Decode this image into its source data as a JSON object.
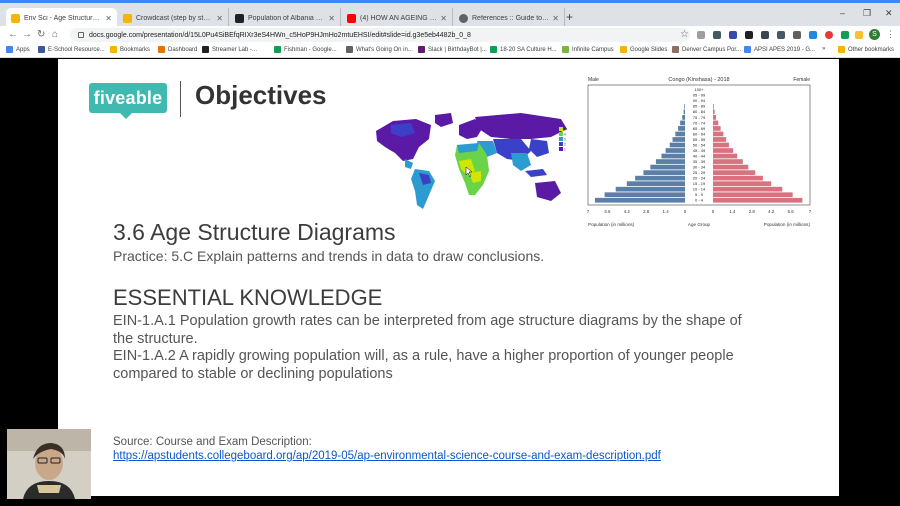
{
  "browser": {
    "tabs": [
      {
        "title": "Env Sci - Age Structure Diagrams",
        "icon": "slides-icon",
        "color": "#f4b400",
        "active": true
      },
      {
        "title": "Crowdcast (step by step) - Google",
        "icon": "slides-icon",
        "color": "#f4b400",
        "active": false
      },
      {
        "title": "Population of Albania 2017 - Pop",
        "icon": "site-icon",
        "color": "#202124",
        "active": false
      },
      {
        "title": "(4) HOW AN AGEING POPULATIO",
        "icon": "youtube-icon",
        "color": "#ff0000",
        "active": false
      },
      {
        "title": "References :: Guide to Country P",
        "icon": "globe-icon",
        "color": "#5f6368",
        "active": false
      }
    ],
    "url": "docs.google.com/presentation/d/15L0Pu4SiBEfqRIXr3eS4HWn_c5HoP9HJmHo2mtuEHSI/edit#slide=id.g3e5eb4482b_0_8",
    "bookmarks": [
      {
        "label": "Apps",
        "color": "#4285f4"
      },
      {
        "label": "E-School Resource...",
        "color": "#3b5998"
      },
      {
        "label": "Bookmarks",
        "color": "#f4b400"
      },
      {
        "label": "Dashboard",
        "color": "#e37400"
      },
      {
        "label": "Streamer Lab -...",
        "color": "#202124"
      },
      {
        "label": "Fishman - Google...",
        "color": "#0f9d58"
      },
      {
        "label": "What's Going On in...",
        "color": "#5f6368"
      },
      {
        "label": "Slack | BirthdayBot |...",
        "color": "#611f69"
      },
      {
        "label": "18-20 SA Culture H...",
        "color": "#0f9d58"
      },
      {
        "label": "Infinite Campus",
        "color": "#7cb342"
      },
      {
        "label": "Google Slides",
        "color": "#f4b400"
      },
      {
        "label": "Denver Campus Por...",
        "color": "#8d6e63"
      },
      {
        "label": "APSI APES 2019 - G...",
        "color": "#4285f4"
      },
      {
        "label": "Other bookmarks",
        "color": "#f4b400"
      }
    ],
    "more_bookmarks": "»",
    "profile_initial": "S"
  },
  "slide": {
    "logo_text": "fiveable",
    "header": "Objectives",
    "title": "3.6 Age Structure Diagrams",
    "practice": "Practice: 5.C Explain patterns and trends in data to draw conclusions.",
    "ek_heading": "ESSENTIAL KNOWLEDGE",
    "ek1": "EIN-1.A.1 Population growth rates can be interpreted from age structure diagrams by the shape of the structure.",
    "ek2": "EIN-1.A.2 A rapidly growing population will, as a rule, have a higher proportion of younger people compared to stable or declining populations",
    "source_label": "Source: Course and Exam Description:",
    "source_link": "https://apstudents.collegeboard.org/ap/2019-05/ap-environmental-science-course-and-exam-description.pdf",
    "map_legend": [
      "5+",
      "4",
      "3",
      "2",
      "1"
    ],
    "map_legend_colors": [
      "#cfe600",
      "#6bd34a",
      "#2c9bd0",
      "#3b40c8",
      "#5b1aa6"
    ]
  },
  "chart_data": {
    "type": "bar",
    "title": "Congo (Kinshasa) - 2018",
    "left_label": "Male",
    "right_label": "Female",
    "xlabel_left": "Population (in millions)",
    "xlabel_center": "Age Group",
    "xlabel_right": "Population (in millions)",
    "xticks_left": [
      "7",
      "5.6",
      "4.2",
      "2.8",
      "1.4",
      "0"
    ],
    "xticks_right": [
      "0",
      "1.4",
      "2.8",
      "4.2",
      "5.6",
      "7"
    ],
    "xlim": [
      0,
      7
    ],
    "categories": [
      "100+",
      "95 - 99",
      "90 - 94",
      "85 - 89",
      "80 - 84",
      "75 - 79",
      "70 - 74",
      "65 - 69",
      "60 - 64",
      "55 - 59",
      "50 - 54",
      "45 - 49",
      "40 - 44",
      "35 - 39",
      "30 - 34",
      "25 - 29",
      "20 - 24",
      "15 - 19",
      "10 - 14",
      "5 - 9",
      "0 - 4"
    ],
    "series": [
      {
        "name": "Male",
        "color": "#5b7fa6",
        "values": [
          0,
          0,
          0,
          0.05,
          0.1,
          0.2,
          0.35,
          0.5,
          0.7,
          0.9,
          1.1,
          1.4,
          1.7,
          2.1,
          2.5,
          3.0,
          3.6,
          4.2,
          5.0,
          5.8,
          6.5
        ]
      },
      {
        "name": "Female",
        "color": "#d9727f",
        "values": [
          0,
          0,
          0,
          0.06,
          0.12,
          0.22,
          0.38,
          0.55,
          0.75,
          0.95,
          1.15,
          1.45,
          1.75,
          2.15,
          2.55,
          3.05,
          3.6,
          4.2,
          5.0,
          5.75,
          6.45
        ]
      }
    ]
  }
}
